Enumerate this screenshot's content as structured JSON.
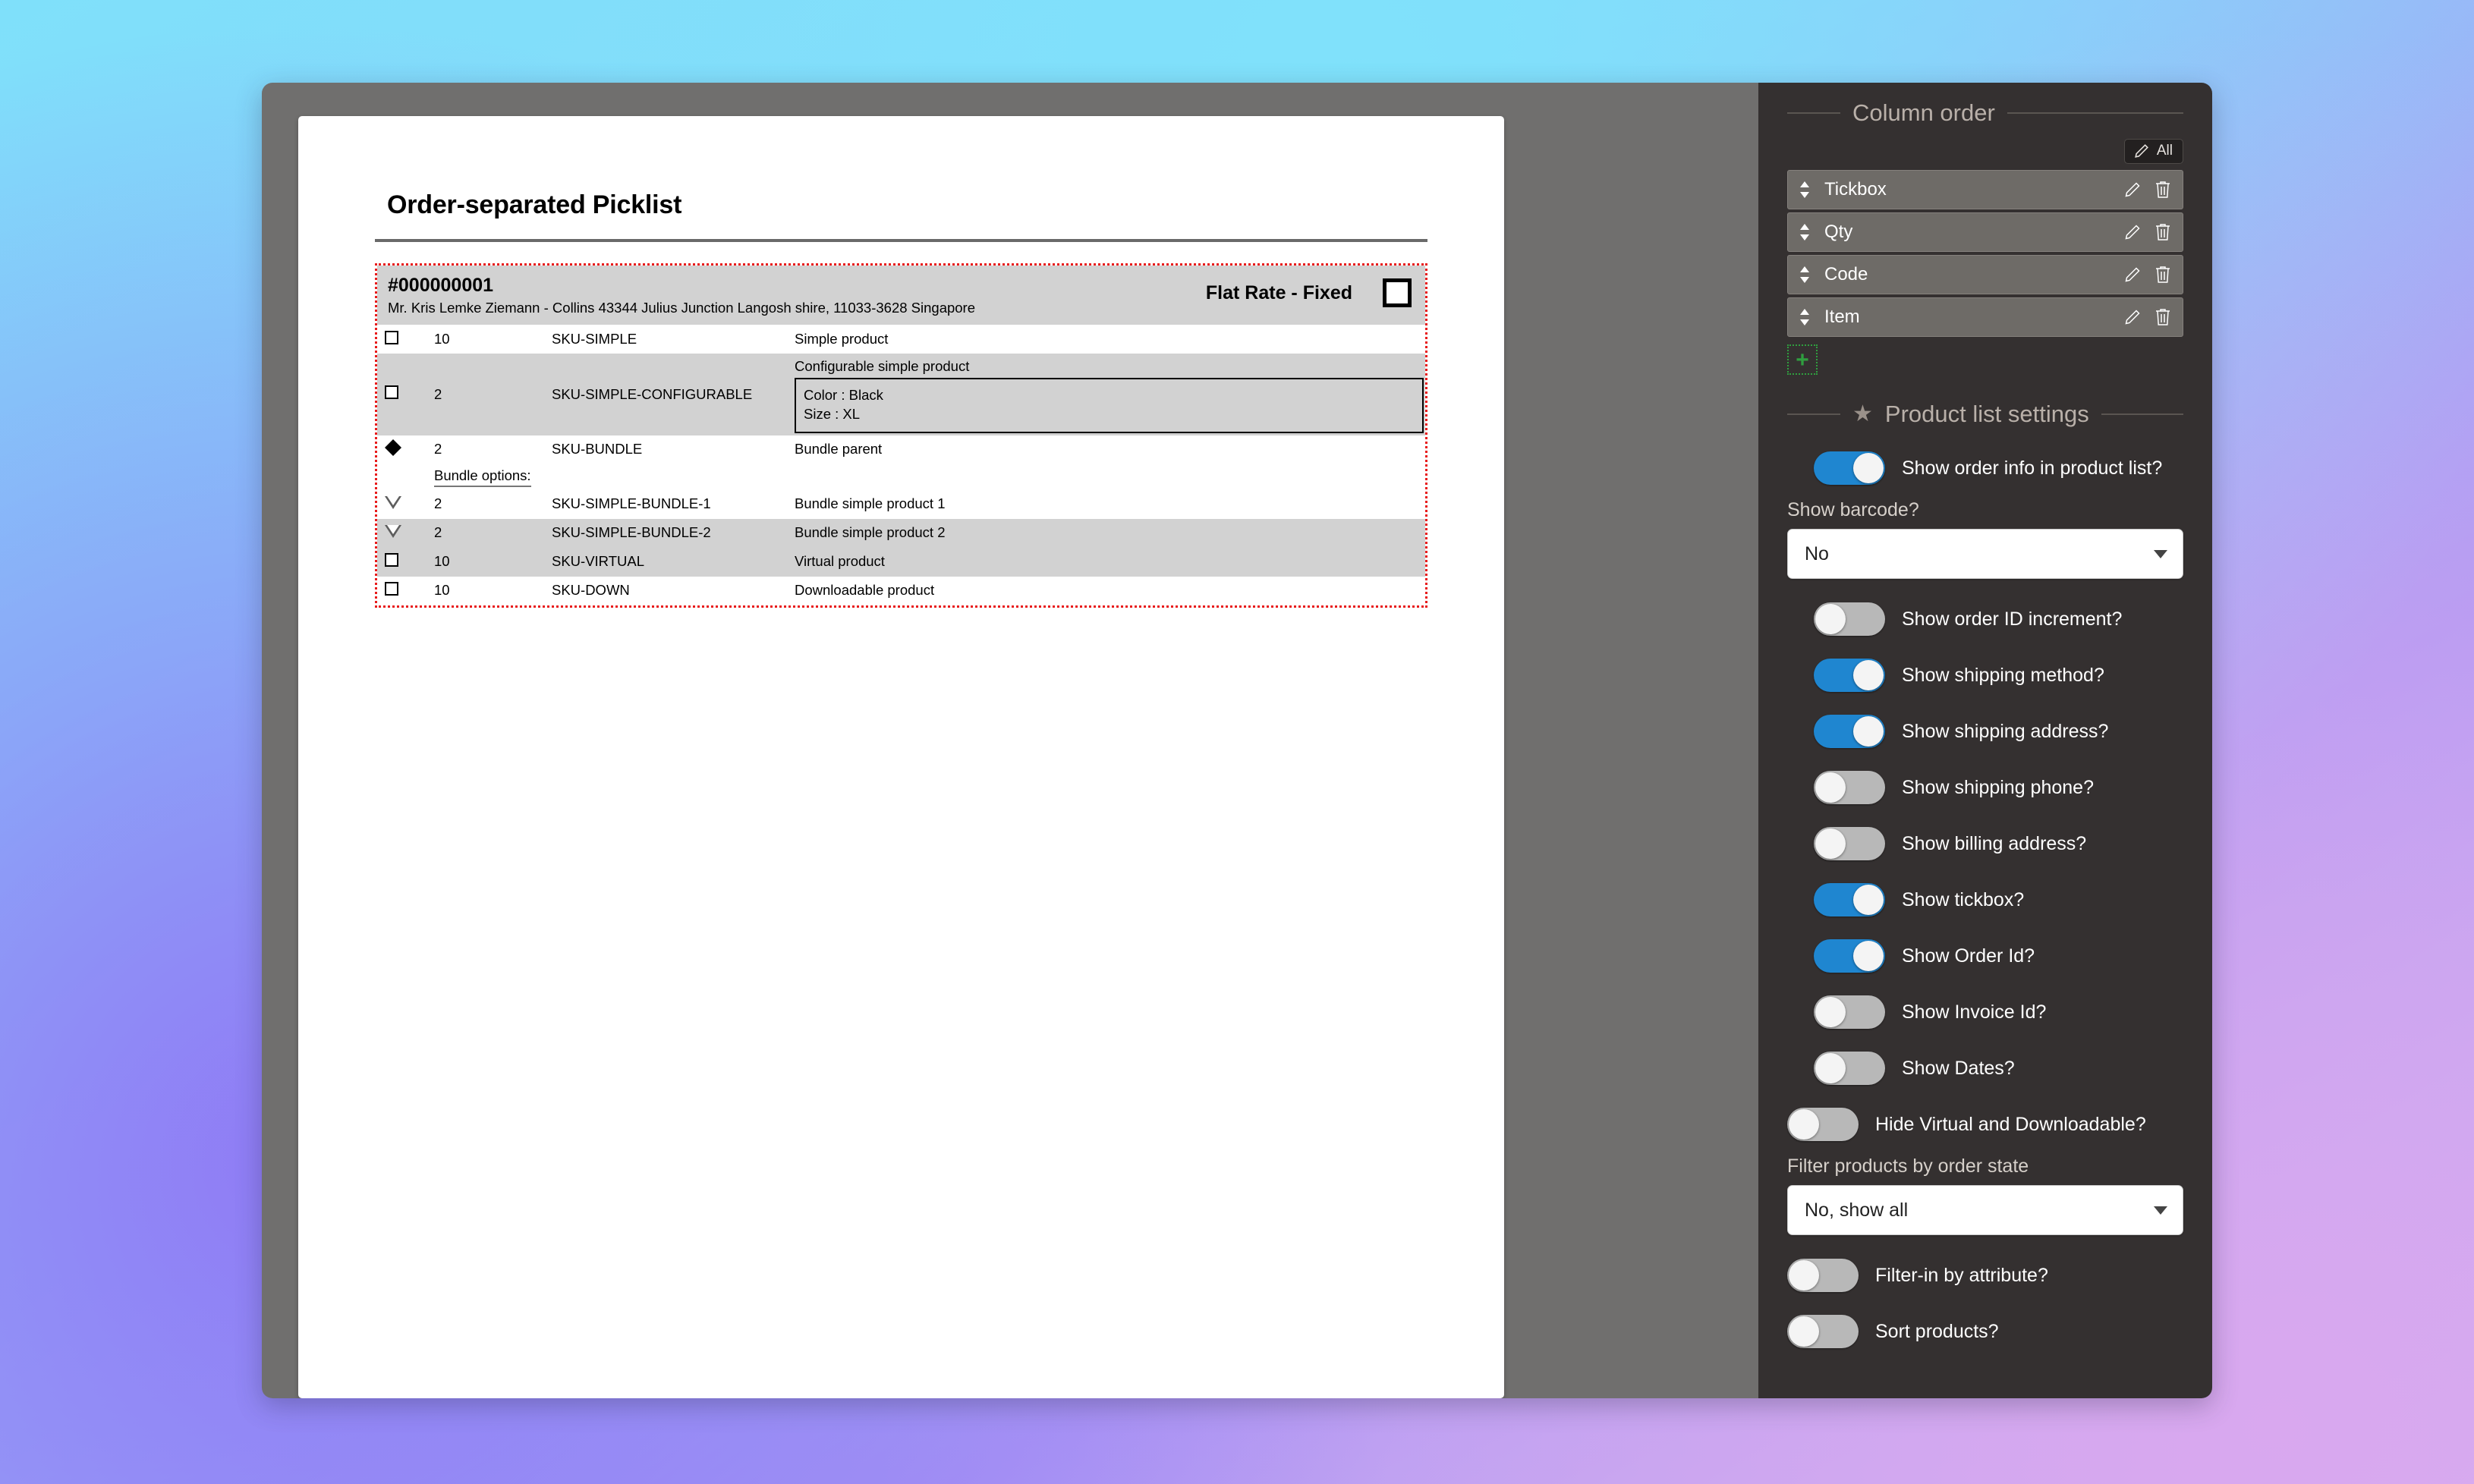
{
  "document": {
    "title": "Order-separated Picklist",
    "order": {
      "id": "#000000001",
      "address": "Mr. Kris Lemke Ziemann - Collins 43344 Julius Junction Langosh shire, 11033-3628 Singapore",
      "shipping_method": "Flat Rate - Fixed"
    },
    "bundle_options_label": "Bundle options:",
    "rows": [
      {
        "marker": "tickbox",
        "qty": "10",
        "code": "SKU-SIMPLE",
        "item": "Simple product",
        "shaded": false
      },
      {
        "marker": "tickbox",
        "qty": "2",
        "code": "SKU-SIMPLE-CONFIGURABLE",
        "item": "Configurable simple product",
        "shaded": true,
        "options": [
          "Color : Black",
          "Size : XL"
        ]
      },
      {
        "marker": "diamond",
        "qty": "2",
        "code": "SKU-BUNDLE",
        "item": "Bundle parent",
        "shaded": false
      },
      {
        "marker": "triangle",
        "qty": "2",
        "code": "SKU-SIMPLE-BUNDLE-1",
        "item": "Bundle simple product 1",
        "shaded": false
      },
      {
        "marker": "triangle",
        "qty": "2",
        "code": "SKU-SIMPLE-BUNDLE-2",
        "item": "Bundle simple product 2",
        "shaded": true
      },
      {
        "marker": "tickbox",
        "qty": "10",
        "code": "SKU-VIRTUAL",
        "item": "Virtual product",
        "shaded": true
      },
      {
        "marker": "tickbox",
        "qty": "10",
        "code": "SKU-DOWN",
        "item": "Downloadable product",
        "shaded": false
      }
    ]
  },
  "panel": {
    "column_order": {
      "title": "Column order",
      "edit_all_label": "All",
      "items": [
        {
          "label": "Tickbox"
        },
        {
          "label": "Qty"
        },
        {
          "label": "Code"
        },
        {
          "label": "Item"
        }
      ]
    },
    "product_list_settings": {
      "title": "Product list settings",
      "show_order_info": {
        "label": "Show order info in product list?",
        "value": true
      },
      "show_barcode": {
        "label": "Show barcode?",
        "value": "No"
      },
      "toggles": [
        {
          "label": "Show order ID increment?",
          "value": false
        },
        {
          "label": "Show shipping method?",
          "value": true
        },
        {
          "label": "Show shipping address?",
          "value": true
        },
        {
          "label": "Show shipping phone?",
          "value": false
        },
        {
          "label": "Show billing address?",
          "value": false
        },
        {
          "label": "Show tickbox?",
          "value": true
        },
        {
          "label": "Show Order Id?",
          "value": true
        },
        {
          "label": "Show Invoice Id?",
          "value": false
        },
        {
          "label": "Show Dates?",
          "value": false
        }
      ],
      "hide_virtual": {
        "label": "Hide Virtual and Downloadable?",
        "value": false
      },
      "filter_order_state": {
        "label": "Filter products by order state",
        "value": "No, show all"
      },
      "filter_attribute": {
        "label": "Filter-in by attribute?",
        "value": false
      },
      "sort_products": {
        "label": "Sort products?",
        "value": false
      }
    }
  },
  "colors": {
    "accent_on": "#1f86d0",
    "panel_bg": "#343030",
    "picklist_border": "#e81b1b",
    "row_shade": "#d2d2d2",
    "add_green": "#2f9e3f"
  }
}
